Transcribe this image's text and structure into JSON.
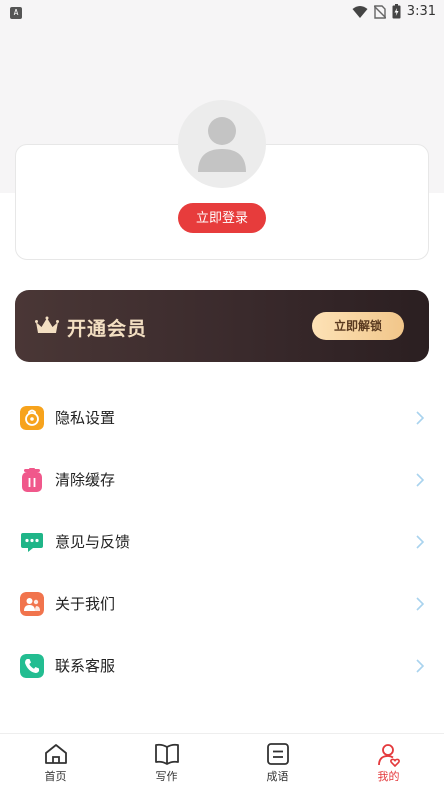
{
  "status_bar": {
    "app_badge": "A",
    "time": "3:31",
    "icons": [
      "wifi-icon",
      "no-sim-icon",
      "battery-charging-icon"
    ]
  },
  "profile": {
    "avatar_icon": "default-avatar-icon",
    "login_label": "立即登录"
  },
  "vip": {
    "icon": "crown-icon",
    "title": "开通会员",
    "unlock_label": "立即解锁"
  },
  "menu": {
    "items": [
      {
        "label": "隐私设置",
        "icon": "privacy-icon",
        "color": "#f7a31c"
      },
      {
        "label": "清除缓存",
        "icon": "trash-icon",
        "color": "#f0588b"
      },
      {
        "label": "意见与反馈",
        "icon": "feedback-icon",
        "color": "#1fb588"
      },
      {
        "label": "关于我们",
        "icon": "about-us-icon",
        "color": "#f1744d"
      },
      {
        "label": "联系客服",
        "icon": "phone-icon",
        "color": "#23bd91"
      }
    ]
  },
  "tab_bar": {
    "tabs": [
      {
        "label": "首页",
        "icon": "home-icon"
      },
      {
        "label": "写作",
        "icon": "book-icon"
      },
      {
        "label": "成语",
        "icon": "idiom-icon"
      },
      {
        "label": "我的",
        "icon": "profile-icon",
        "active": true
      }
    ],
    "active_color": "#e4393c"
  }
}
